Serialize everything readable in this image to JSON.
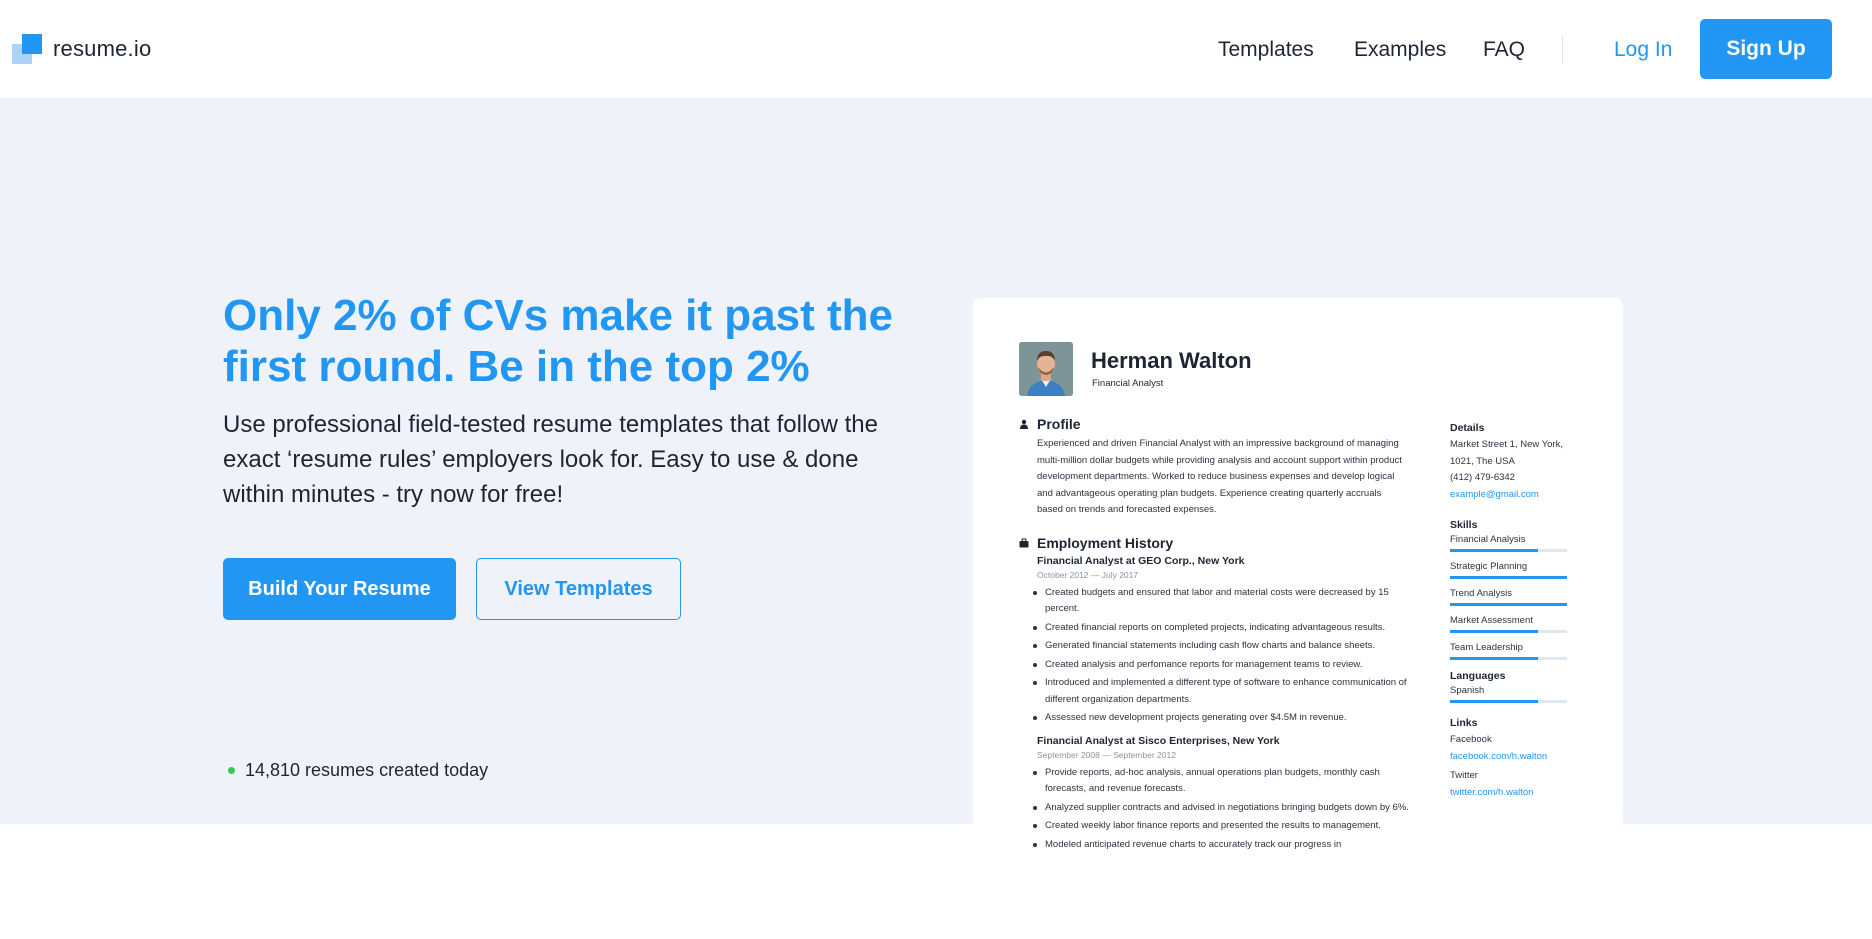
{
  "brand": {
    "name": "resume.io",
    "accent": "#2196f3"
  },
  "nav": {
    "items": [
      "Templates",
      "Examples",
      "FAQ"
    ],
    "login": "Log In",
    "signup": "Sign Up"
  },
  "hero": {
    "headline": "Only 2% of CVs make it past the first round. Be in the top 2%",
    "subtext": "Use professional field-tested resume templates that follow the exact ‘resume rules’ employers look for. Easy to use & done within minutes - try now for free!",
    "primary_button": "Build Your Resume",
    "secondary_button": "View Templates",
    "counter": "14,810 resumes created today",
    "counter_dot_color": "#34c759"
  },
  "resume": {
    "name": "Herman Walton",
    "role": "Financial Analyst",
    "profile": {
      "heading": "Profile",
      "icon": "person-icon",
      "text": "Experienced and driven Financial Analyst with an impressive background of managing multi-million dollar budgets while providing analysis and account support within product development departments. Worked to reduce business expenses and develop logical and advantageous operating plan budgets. Experience creating quarterly accruals based on trends and forecasted expenses."
    },
    "employment": {
      "heading": "Employment History",
      "icon": "briefcase-icon",
      "jobs": [
        {
          "title": "Financial Analyst at GEO Corp., New York",
          "dates": "October 2012 — July 2017",
          "bullets": [
            "Created budgets and ensured that labor and material costs were decreased by 15 percent.",
            "Created financial reports on completed projects, indicating advantageous results.",
            "Generated financial statements including cash flow charts and balance sheets.",
            "Created analysis and perfomance reports for management teams to review.",
            "Introduced and implemented a different type of software to enhance communication of different organization departments.",
            "Assessed new development projects generating over $4.5M in revenue."
          ]
        },
        {
          "title": "Financial Analyst at Sisco Enterprises, New York",
          "dates": "September 2008 — September 2012",
          "bullets": [
            "Provide reports, ad-hoc analysis, annual operations plan budgets, monthly cash forecasts, and revenue forecasts.",
            "Analyzed supplier contracts and advised in negotiations bringing budgets down by 6%.",
            "Created weekly labor finance reports and presented the results to management.",
            "Modeled anticipated revenue charts to accurately track our progress in"
          ]
        }
      ]
    },
    "details": {
      "heading": "Details",
      "address_line1": "Market Street 1, New York,",
      "address_line2": "1021, The USA",
      "phone": "(412) 479-6342",
      "email": "example@gmail.com"
    },
    "skills": {
      "heading": "Skills",
      "items": [
        {
          "name": "Financial Analysis",
          "level": 0.75
        },
        {
          "name": "Strategic Planning",
          "level": 1.0
        },
        {
          "name": "Trend Analysis",
          "level": 1.0
        },
        {
          "name": "Market Assessment",
          "level": 0.75
        },
        {
          "name": "Team Leadership",
          "level": 0.75
        }
      ]
    },
    "languages": {
      "heading": "Languages",
      "items": [
        {
          "name": "Spanish",
          "level": 0.75
        }
      ]
    },
    "links": {
      "heading": "Links",
      "items": [
        {
          "label": "Facebook",
          "url": "facebook.com/h.walton"
        },
        {
          "label": "Twitter",
          "url": "twitter.com/h.walton"
        }
      ]
    }
  }
}
